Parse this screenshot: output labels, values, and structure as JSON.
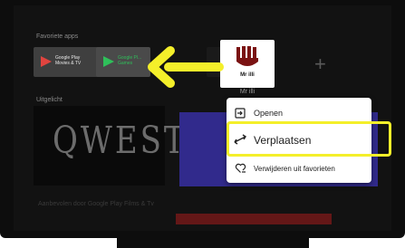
{
  "favorites": {
    "title": "Favoriete apps",
    "apps": [
      {
        "name": "Google Play Movies & TV",
        "line1": "Google Play",
        "line2": "Movies & TV"
      },
      {
        "name": "Google Play Games",
        "line1": "Google Pl...",
        "line2": "Games"
      }
    ],
    "focused_app": {
      "label": "Mr illi",
      "sublabel": "Mr illi"
    },
    "add_glyph": "+"
  },
  "section2": {
    "title": "Uitgelicht"
  },
  "qwest": {
    "logo_text": "QWEST"
  },
  "bottom": {
    "text": "Aanbevolen door Google Play Films & Tv"
  },
  "context_menu": {
    "items": [
      {
        "label": "Openen",
        "icon": "open-icon"
      },
      {
        "label": "Verplaatsen",
        "icon": "move-arrows-icon"
      },
      {
        "label": "Verwijderen uit favorieten",
        "icon": "heart-remove-icon"
      }
    ],
    "selected_index": 1
  },
  "colors": {
    "highlight": "#f4ef2a",
    "arrow": "#f4ef2a",
    "purple_panel": "#312a8c",
    "bottom_bar": "#641717"
  }
}
